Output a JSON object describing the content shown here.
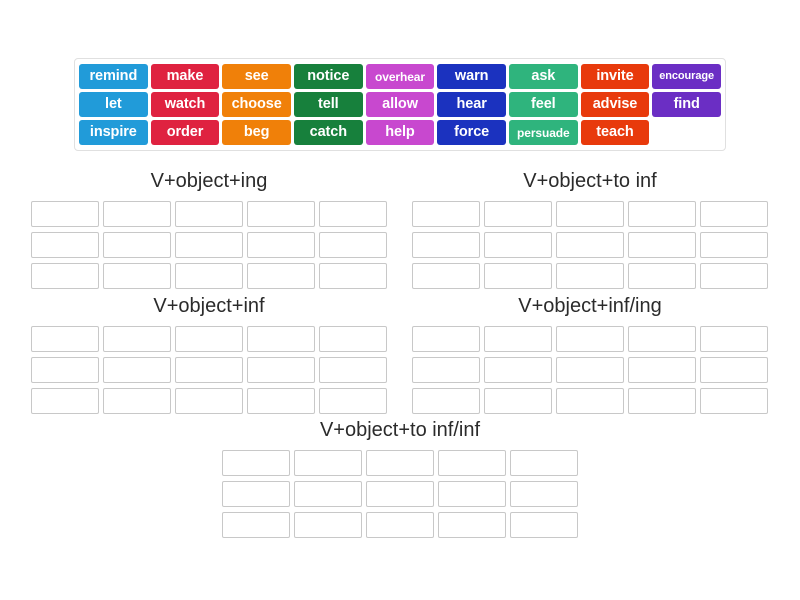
{
  "word_bank": {
    "columns": 9,
    "rows": 3,
    "colors": {
      "blue": "#219bd9",
      "crimson": "#df2240",
      "orange": "#f08009",
      "dark_green": "#17803c",
      "magenta": "#c848cf",
      "dark_blue": "#1b32bf",
      "green": "#2fb47d",
      "orange_red": "#e83a0c",
      "purple": "#6b2ec4"
    },
    "tiles": [
      {
        "label": "remind",
        "color": "#219bd9",
        "size": "normal"
      },
      {
        "label": "make",
        "color": "#df2240",
        "size": "normal"
      },
      {
        "label": "see",
        "color": "#f08009",
        "size": "normal"
      },
      {
        "label": "notice",
        "color": "#17803c",
        "size": "normal"
      },
      {
        "label": "overhear",
        "color": "#c848cf",
        "size": "small"
      },
      {
        "label": "warn",
        "color": "#1b32bf",
        "size": "normal"
      },
      {
        "label": "ask",
        "color": "#2fb47d",
        "size": "normal"
      },
      {
        "label": "invite",
        "color": "#e83a0c",
        "size": "normal"
      },
      {
        "label": "encourage",
        "color": "#6b2ec4",
        "size": "xsmall"
      },
      {
        "label": "let",
        "color": "#219bd9",
        "size": "normal"
      },
      {
        "label": "watch",
        "color": "#df2240",
        "size": "normal"
      },
      {
        "label": "choose",
        "color": "#f08009",
        "size": "normal"
      },
      {
        "label": "tell",
        "color": "#17803c",
        "size": "normal"
      },
      {
        "label": "allow",
        "color": "#c848cf",
        "size": "normal"
      },
      {
        "label": "hear",
        "color": "#1b32bf",
        "size": "normal"
      },
      {
        "label": "feel",
        "color": "#2fb47d",
        "size": "normal"
      },
      {
        "label": "advise",
        "color": "#e83a0c",
        "size": "normal"
      },
      {
        "label": "find",
        "color": "#6b2ec4",
        "size": "normal"
      },
      {
        "label": "inspire",
        "color": "#219bd9",
        "size": "normal"
      },
      {
        "label": "order",
        "color": "#df2240",
        "size": "normal"
      },
      {
        "label": "beg",
        "color": "#f08009",
        "size": "normal"
      },
      {
        "label": "catch",
        "color": "#17803c",
        "size": "normal"
      },
      {
        "label": "help",
        "color": "#c848cf",
        "size": "normal"
      },
      {
        "label": "force",
        "color": "#1b32bf",
        "size": "normal"
      },
      {
        "label": "persuade",
        "color": "#2fb47d",
        "size": "small"
      },
      {
        "label": "teach",
        "color": "#e83a0c",
        "size": "normal"
      },
      {
        "label": "",
        "color": "",
        "size": "empty"
      }
    ]
  },
  "groups": [
    {
      "id": "group-ing",
      "title": "V+object+ing",
      "columns": 5,
      "rows": 3,
      "slots": 15
    },
    {
      "id": "group-to-inf",
      "title": "V+object+to inf",
      "columns": 5,
      "rows": 3,
      "slots": 15
    },
    {
      "id": "group-inf",
      "title": "V+object+inf",
      "columns": 5,
      "rows": 3,
      "slots": 15
    },
    {
      "id": "group-inf-ing",
      "title": "V+object+inf/ing",
      "columns": 5,
      "rows": 3,
      "slots": 15
    },
    {
      "id": "group-to-inf-inf",
      "title": "V+object+to inf/inf",
      "columns": 5,
      "rows": 3,
      "slots": 15
    }
  ]
}
